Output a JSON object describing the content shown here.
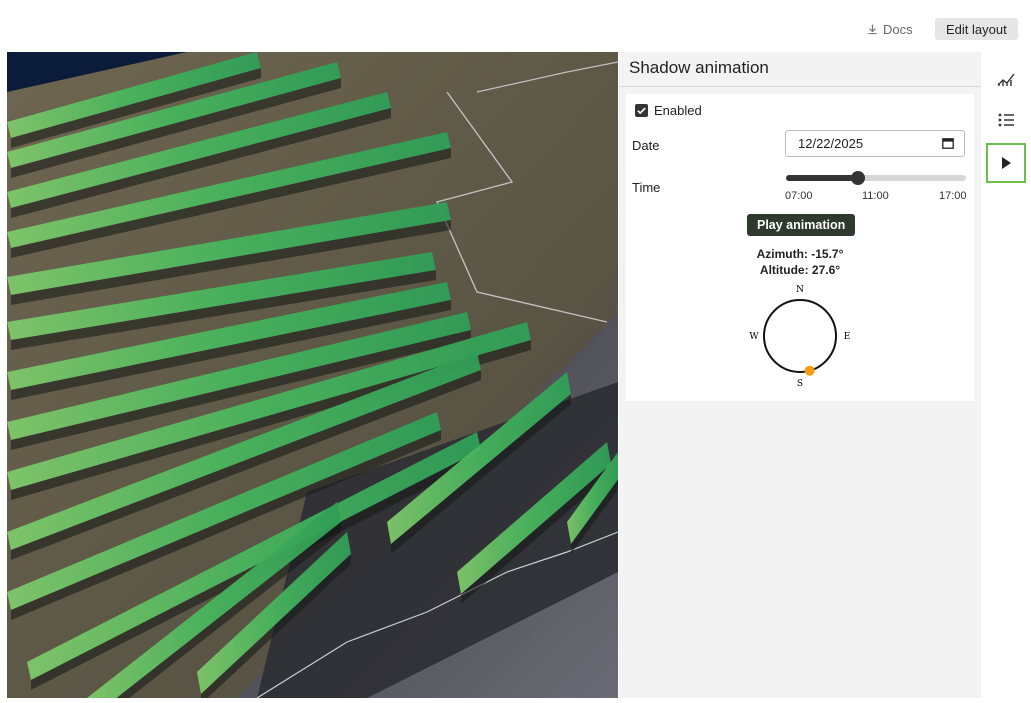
{
  "header": {
    "docs_label": "Docs",
    "edit_layout_label": "Edit layout"
  },
  "panel": {
    "title": "Shadow animation",
    "enabled_label": "Enabled",
    "enabled_checked": true,
    "date_label": "Date",
    "date_value": "12/22/2025",
    "time_label": "Time",
    "time_fraction": 0.4,
    "time_ticks": [
      "07:00",
      "11:00",
      "17:00"
    ],
    "play_label": "Play animation",
    "azimuth_text": "Azimuth: -15.7°",
    "altitude_text": "Altitude: 27.6°",
    "compass": {
      "n": "N",
      "s": "S",
      "e": "E",
      "w": "W"
    },
    "sun_azimuth_deg": -15.7
  },
  "rail": {
    "items": [
      "chart-icon",
      "list-icon",
      "play-icon"
    ],
    "active": "play-icon"
  },
  "colors": {
    "panel_accent": "#6cc04a",
    "sun_marker": "#f39c12",
    "sky": "#0b1b3a",
    "panel_green": "#3fae5b"
  }
}
